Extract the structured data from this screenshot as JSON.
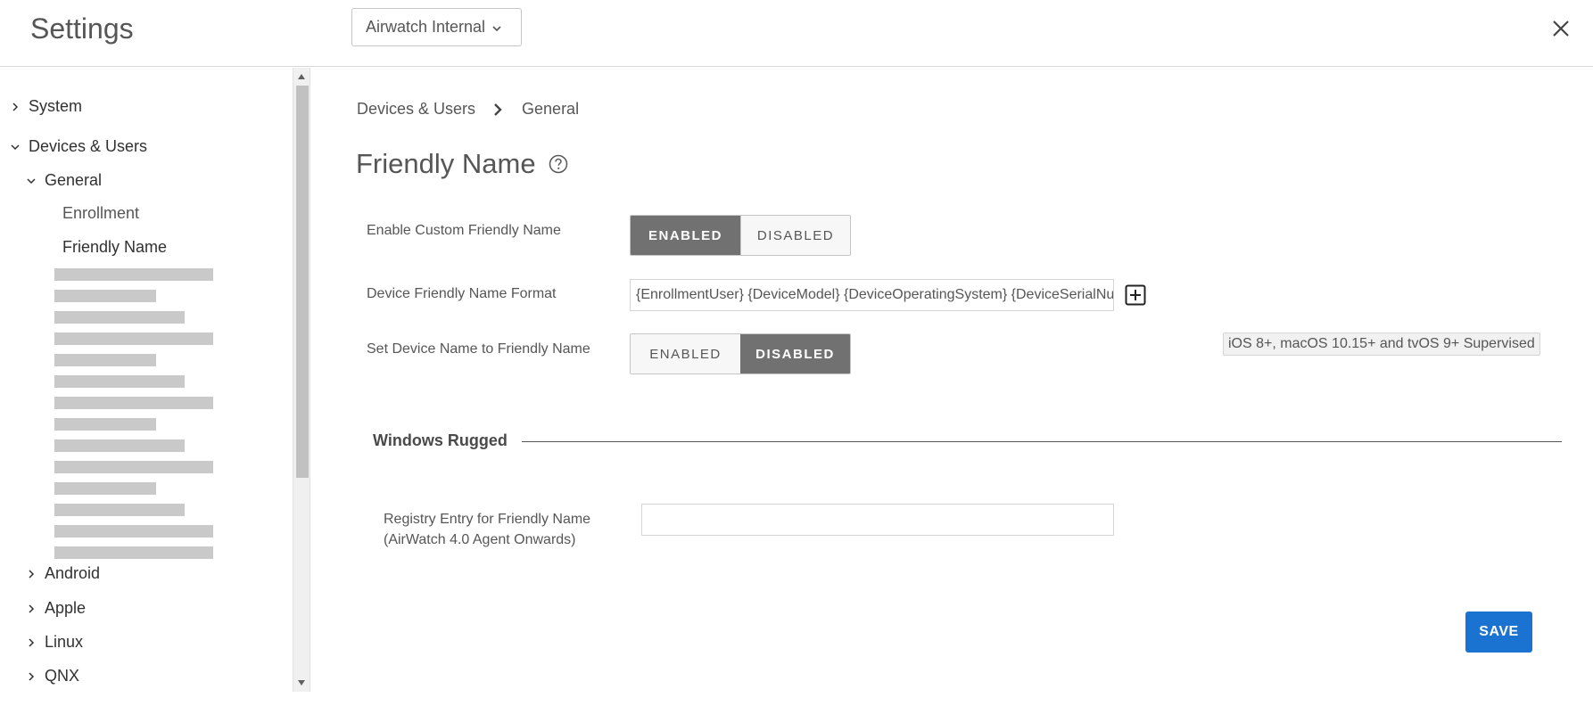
{
  "header": {
    "title": "Settings",
    "org_selector": "Airwatch Internal"
  },
  "sidebar": {
    "system": "System",
    "devices_users": "Devices & Users",
    "general": "General",
    "enrollment": "Enrollment",
    "friendly_name": "Friendly Name",
    "android": "Android",
    "apple": "Apple",
    "linux": "Linux",
    "qnx": "QNX"
  },
  "breadcrumb": {
    "parent": "Devices & Users",
    "current": "General"
  },
  "page": {
    "title": "Friendly Name"
  },
  "fields": {
    "enable_custom_label": "Enable Custom Friendly Name",
    "enable_custom_on": "ENABLED",
    "enable_custom_off": "DISABLED",
    "format_label": "Device Friendly Name Format",
    "format_value": "{EnrollmentUser} {DeviceModel} {DeviceOperatingSystem} {DeviceSerialNumber}",
    "set_device_label": "Set Device Name to Friendly Name",
    "set_device_on": "ENABLED",
    "set_device_off": "DISABLED",
    "set_device_note": "iOS 8+, macOS 10.15+ and tvOS 9+ Supervised"
  },
  "windows_rugged": {
    "section_title": "Windows Rugged",
    "registry_label_line1": "Registry Entry for Friendly Name",
    "registry_label_line2": "(AirWatch 4.0 Agent Onwards)",
    "registry_value": ""
  },
  "actions": {
    "save": "SAVE"
  },
  "state": {
    "enable_custom_selected": "ENABLED",
    "set_device_selected": "DISABLED"
  },
  "colors": {
    "accent": "#1a73d1",
    "toggle_active": "#717171"
  }
}
